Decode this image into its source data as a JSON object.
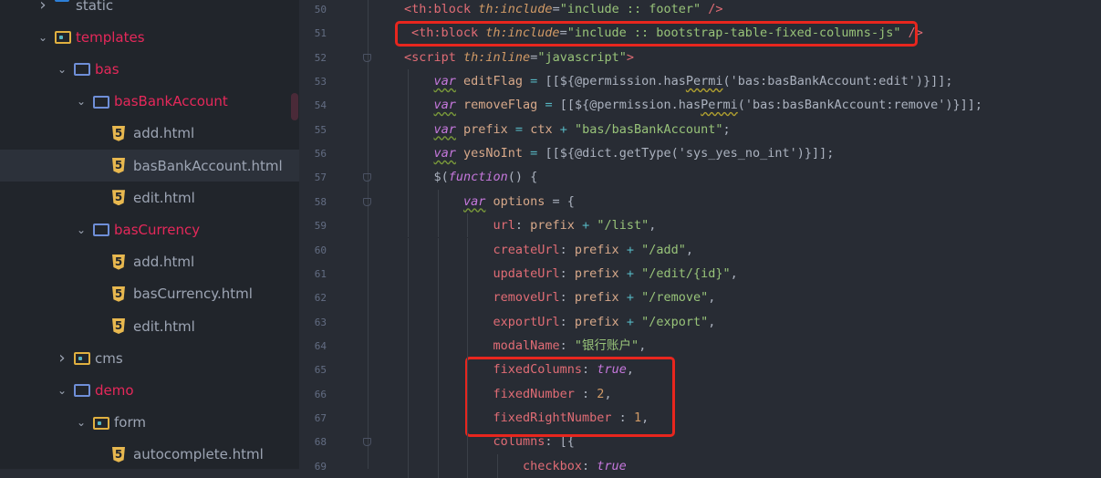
{
  "file_tree": [
    {
      "label": "static",
      "depth": 0,
      "expanded": false,
      "icon": "globe-folder-icon",
      "modified": false
    },
    {
      "label": "templates",
      "depth": 0,
      "expanded": true,
      "icon": "folder-yellow-icon",
      "modified": true
    },
    {
      "label": "bas",
      "depth": 1,
      "expanded": true,
      "icon": "folder-icon",
      "modified": true
    },
    {
      "label": "basBankAccount",
      "depth": 2,
      "expanded": true,
      "icon": "folder-icon",
      "modified": true
    },
    {
      "label": "add.html",
      "depth": 3,
      "icon": "html5-icon"
    },
    {
      "label": "basBankAccount.html",
      "depth": 3,
      "icon": "html5-icon",
      "selected": true
    },
    {
      "label": "edit.html",
      "depth": 3,
      "icon": "html5-icon"
    },
    {
      "label": "basCurrency",
      "depth": 2,
      "expanded": true,
      "icon": "folder-icon",
      "modified": true
    },
    {
      "label": "add.html",
      "depth": 3,
      "icon": "html5-icon"
    },
    {
      "label": "basCurrency.html",
      "depth": 3,
      "icon": "html5-icon"
    },
    {
      "label": "edit.html",
      "depth": 3,
      "icon": "html5-icon"
    },
    {
      "label": "cms",
      "depth": 1,
      "expanded": false,
      "icon": "folder-yellow-icon",
      "modified": false
    },
    {
      "label": "demo",
      "depth": 1,
      "expanded": true,
      "icon": "folder-icon",
      "modified": true
    },
    {
      "label": "form",
      "depth": 2,
      "expanded": true,
      "icon": "folder-yellow-icon",
      "modified": false
    },
    {
      "label": "autocomplete.html",
      "depth": 3,
      "icon": "html5-icon"
    }
  ],
  "editor": {
    "lines": [
      {
        "n": "50",
        "indent": 0,
        "fold": false,
        "tokens": [
          [
            "<th:block ",
            "tag"
          ],
          [
            "th:include",
            "attr"
          ],
          [
            "=",
            "punc"
          ],
          [
            "\"include :: footer\"",
            "str"
          ],
          [
            " />",
            "tag"
          ]
        ]
      },
      {
        "n": "51",
        "indent": 0,
        "fold": false,
        "lead": " ",
        "tokens": [
          [
            "<th:block ",
            "tag"
          ],
          [
            "th:include",
            "attr"
          ],
          [
            "=",
            "punc"
          ],
          [
            "\"include :: bootstrap-table-fixed-columns-js\"",
            "str"
          ],
          [
            " />",
            "tag"
          ]
        ]
      },
      {
        "n": "52",
        "indent": 0,
        "fold": true,
        "tokens": [
          [
            "<script ",
            "tag"
          ],
          [
            "th:inline",
            "attr"
          ],
          [
            "=",
            "punc"
          ],
          [
            "\"javascript\"",
            "str"
          ],
          [
            ">",
            "tag"
          ]
        ]
      },
      {
        "n": "53",
        "indent": 1,
        "fold": false,
        "tokens": [
          [
            "var",
            "kw"
          ],
          [
            " editFlag ",
            "var"
          ],
          [
            "= ",
            "op"
          ],
          [
            "[[${@permission.has",
            "punc"
          ],
          [
            "Permi",
            "punc warn"
          ],
          [
            "('bas:basBankAccount:edit')}]];",
            "punc"
          ]
        ]
      },
      {
        "n": "54",
        "indent": 1,
        "fold": false,
        "tokens": [
          [
            "var",
            "kw"
          ],
          [
            " removeFlag ",
            "var"
          ],
          [
            "= ",
            "op"
          ],
          [
            "[[${@permission.has",
            "punc"
          ],
          [
            "Permi",
            "punc warn"
          ],
          [
            "('bas:basBankAccount:remove')}]];",
            "punc"
          ]
        ]
      },
      {
        "n": "55",
        "indent": 1,
        "fold": false,
        "tokens": [
          [
            "var",
            "kw"
          ],
          [
            " prefix ",
            "var"
          ],
          [
            "= ",
            "op"
          ],
          [
            "ctx ",
            "var"
          ],
          [
            "+ ",
            "op"
          ],
          [
            "\"bas/basBankAccount\"",
            "str"
          ],
          [
            ";",
            "punc"
          ]
        ]
      },
      {
        "n": "56",
        "indent": 1,
        "fold": false,
        "tokens": [
          [
            "var",
            "kw"
          ],
          [
            " yesNoInt ",
            "var"
          ],
          [
            "= ",
            "op"
          ],
          [
            "[[${@dict.getType('sys_yes_no_int')}]];",
            "punc"
          ]
        ]
      },
      {
        "n": "57",
        "indent": 1,
        "fold": true,
        "tokens": [
          [
            "$(",
            "punc"
          ],
          [
            "function",
            "fn"
          ],
          [
            "() {",
            "punc"
          ]
        ]
      },
      {
        "n": "58",
        "indent": 2,
        "fold": true,
        "tokens": [
          [
            "var",
            "kw"
          ],
          [
            " options ",
            "var"
          ],
          [
            "= {",
            "punc"
          ]
        ]
      },
      {
        "n": "59",
        "indent": 3,
        "fold": false,
        "tokens": [
          [
            "url",
            "prop"
          ],
          [
            ": ",
            "punc"
          ],
          [
            "prefix ",
            "var"
          ],
          [
            "+ ",
            "op"
          ],
          [
            "\"/list\"",
            "str"
          ],
          [
            ",",
            "punc"
          ]
        ]
      },
      {
        "n": "60",
        "indent": 3,
        "fold": false,
        "tokens": [
          [
            "createUrl",
            "prop"
          ],
          [
            ": ",
            "punc"
          ],
          [
            "prefix ",
            "var"
          ],
          [
            "+ ",
            "op"
          ],
          [
            "\"/add\"",
            "str"
          ],
          [
            ",",
            "punc"
          ]
        ]
      },
      {
        "n": "61",
        "indent": 3,
        "fold": false,
        "tokens": [
          [
            "updateUrl",
            "prop"
          ],
          [
            ": ",
            "punc"
          ],
          [
            "prefix ",
            "var"
          ],
          [
            "+ ",
            "op"
          ],
          [
            "\"/edit/{id}\"",
            "str"
          ],
          [
            ",",
            "punc"
          ]
        ]
      },
      {
        "n": "62",
        "indent": 3,
        "fold": false,
        "tokens": [
          [
            "removeUrl",
            "prop"
          ],
          [
            ": ",
            "punc"
          ],
          [
            "prefix ",
            "var"
          ],
          [
            "+ ",
            "op"
          ],
          [
            "\"/remove\"",
            "str"
          ],
          [
            ",",
            "punc"
          ]
        ]
      },
      {
        "n": "63",
        "indent": 3,
        "fold": false,
        "tokens": [
          [
            "exportUrl",
            "prop"
          ],
          [
            ": ",
            "punc"
          ],
          [
            "prefix ",
            "var"
          ],
          [
            "+ ",
            "op"
          ],
          [
            "\"/export\"",
            "str"
          ],
          [
            ",",
            "punc"
          ]
        ]
      },
      {
        "n": "64",
        "indent": 3,
        "fold": false,
        "tokens": [
          [
            "modalName",
            "prop"
          ],
          [
            ": ",
            "punc"
          ],
          [
            "\"银行账户\"",
            "str"
          ],
          [
            ",",
            "punc"
          ]
        ]
      },
      {
        "n": "65",
        "indent": 3,
        "fold": false,
        "tokens": [
          [
            "fixedColumns",
            "prop"
          ],
          [
            ": ",
            "punc"
          ],
          [
            "true",
            "bool"
          ],
          [
            ",",
            "punc"
          ]
        ]
      },
      {
        "n": "66",
        "indent": 3,
        "fold": false,
        "tokens": [
          [
            "fixedNumber",
            "prop"
          ],
          [
            " : ",
            "punc"
          ],
          [
            "2",
            "num"
          ],
          [
            ",",
            "punc"
          ]
        ]
      },
      {
        "n": "67",
        "indent": 3,
        "fold": false,
        "tokens": [
          [
            "fixedRightNumber",
            "prop"
          ],
          [
            " : ",
            "punc"
          ],
          [
            "1",
            "num"
          ],
          [
            ",",
            "punc"
          ]
        ]
      },
      {
        "n": "68",
        "indent": 3,
        "fold": true,
        "tokens": [
          [
            "columns",
            "prop"
          ],
          [
            ": [{",
            "punc"
          ]
        ]
      },
      {
        "n": "69",
        "indent": 4,
        "fold": false,
        "tokens": [
          [
            "checkbox",
            "prop"
          ],
          [
            ": ",
            "punc"
          ],
          [
            "true",
            "bool"
          ]
        ]
      }
    ]
  },
  "colors": {
    "highlight_box": "#e8261e",
    "modified_label": "#e5285a",
    "background": "#282c34"
  }
}
